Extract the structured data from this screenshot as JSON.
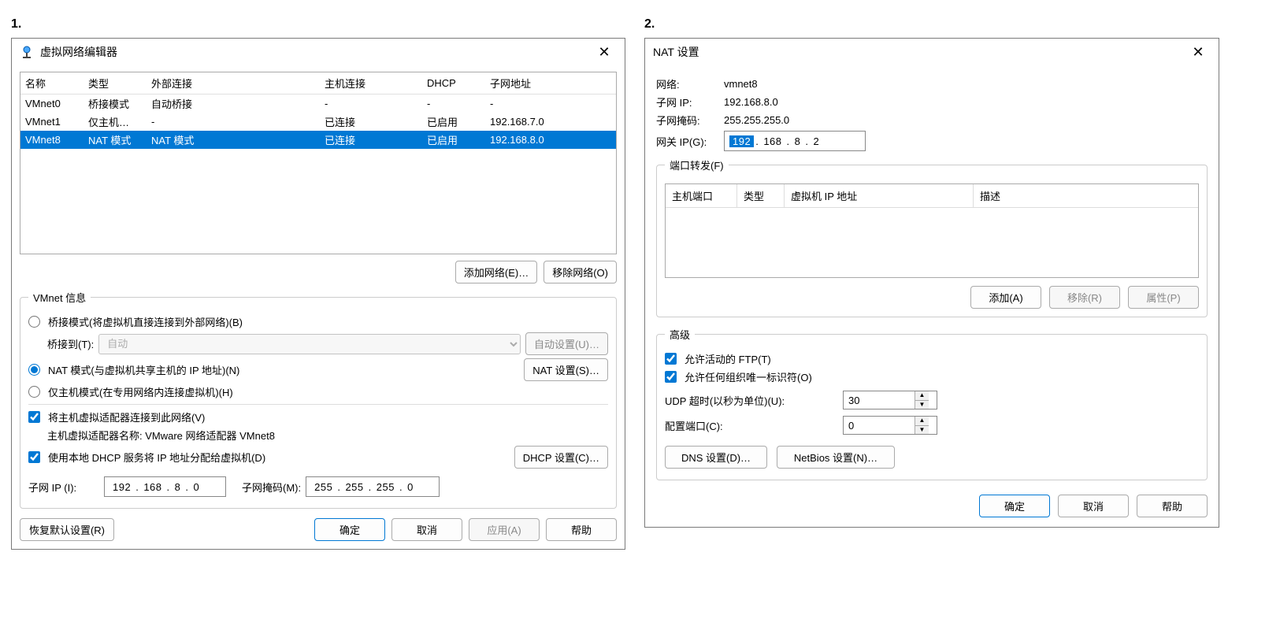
{
  "labels": {
    "one": "1.",
    "two": "2."
  },
  "dlg1": {
    "title": "虚拟网络编辑器",
    "table": {
      "headers": [
        "名称",
        "类型",
        "外部连接",
        "主机连接",
        "DHCP",
        "子网地址"
      ],
      "rows": [
        {
          "cells": [
            "VMnet0",
            "桥接模式",
            "自动桥接",
            "-",
            "-",
            "-"
          ],
          "selected": false
        },
        {
          "cells": [
            "VMnet1",
            "仅主机…",
            "-",
            "已连接",
            "已启用",
            "192.168.7.0"
          ],
          "selected": false
        },
        {
          "cells": [
            "VMnet8",
            "NAT 模式",
            "NAT 模式",
            "已连接",
            "已启用",
            "192.168.8.0"
          ],
          "selected": true
        }
      ]
    },
    "add_net": "添加网络(E)…",
    "remove_net": "移除网络(O)",
    "info_legend": "VMnet 信息",
    "radio_bridge": "桥接模式(将虚拟机直接连接到外部网络)(B)",
    "bridge_to_label": "桥接到(T):",
    "bridge_to_value": "自动",
    "auto_setup": "自动设置(U)…",
    "radio_nat": "NAT 模式(与虚拟机共享主机的 IP 地址)(N)",
    "nat_settings": "NAT 设置(S)…",
    "radio_host": "仅主机模式(在专用网络内连接虚拟机)(H)",
    "chk_connect_host": "将主机虚拟适配器连接到此网络(V)",
    "adapter_name": "主机虚拟适配器名称: VMware 网络适配器 VMnet8",
    "chk_dhcp": "使用本地 DHCP 服务将 IP 地址分配给虚拟机(D)",
    "dhcp_settings": "DHCP 设置(C)…",
    "subnet_ip_label": "子网 IP (I):",
    "subnet_ip_octets": [
      "192",
      "168",
      "8",
      "0"
    ],
    "subnet_mask_label": "子网掩码(M):",
    "subnet_mask_octets": [
      "255",
      "255",
      "255",
      "0"
    ],
    "restore": "恢复默认设置(R)",
    "ok": "确定",
    "cancel": "取消",
    "apply": "应用(A)",
    "help": "帮助"
  },
  "dlg2": {
    "title": "NAT 设置",
    "net_label": "网络:",
    "net_value": "vmnet8",
    "subnet_ip_label": "子网 IP:",
    "subnet_ip_value": "192.168.8.0",
    "subnet_mask_label": "子网掩码:",
    "subnet_mask_value": "255.255.255.0",
    "gateway_label": "网关 IP(G):",
    "gateway_octets": [
      "192",
      "168",
      "8",
      "2"
    ],
    "pf_legend": "端口转发(F)",
    "pf_headers": [
      "主机端口",
      "类型",
      "虚拟机 IP 地址",
      "描述"
    ],
    "add": "添加(A)",
    "remove": "移除(R)",
    "props": "属性(P)",
    "adv_legend": "高级",
    "chk_ftp": "允许活动的 FTP(T)",
    "chk_oui": "允许任何组织唯一标识符(O)",
    "udp_label": "UDP 超时(以秒为单位)(U):",
    "udp_value": "30",
    "cfg_port_label": "配置端口(C):",
    "cfg_port_value": "0",
    "dns": "DNS 设置(D)…",
    "netbios": "NetBios 设置(N)…",
    "ok": "确定",
    "cancel": "取消",
    "help": "帮助"
  }
}
